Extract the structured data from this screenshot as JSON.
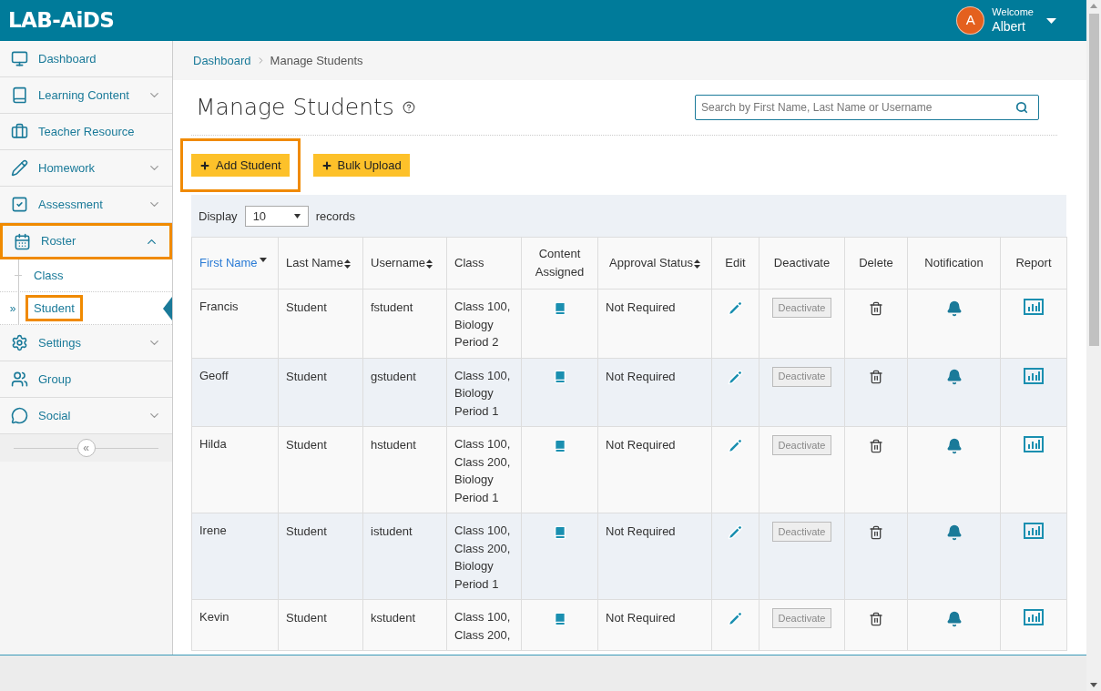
{
  "header": {
    "logo": "LAB-AiDS",
    "avatar_letter": "A",
    "welcome": "Welcome",
    "user": "Albert"
  },
  "sidebar": {
    "items": [
      {
        "label": "Dashboard",
        "has_chevron": false,
        "highlighted": false
      },
      {
        "label": "Learning Content",
        "has_chevron": true,
        "expanded": false,
        "highlighted": false
      },
      {
        "label": "Teacher Resource",
        "has_chevron": false,
        "highlighted": false
      },
      {
        "label": "Homework",
        "has_chevron": true,
        "expanded": false,
        "highlighted": false
      },
      {
        "label": "Assessment",
        "has_chevron": true,
        "expanded": false,
        "highlighted": false
      },
      {
        "label": "Roster",
        "has_chevron": true,
        "expanded": true,
        "highlighted": true,
        "children": [
          {
            "label": "Class",
            "selected": false,
            "highlighted": false
          },
          {
            "label": "Student",
            "selected": true,
            "highlighted": true,
            "marker": "»"
          }
        ]
      },
      {
        "label": "Settings",
        "has_chevron": true,
        "expanded": false,
        "highlighted": false
      },
      {
        "label": "Group",
        "has_chevron": false,
        "highlighted": false
      },
      {
        "label": "Social",
        "has_chevron": true,
        "expanded": false,
        "highlighted": false
      }
    ],
    "collapse": "«"
  },
  "breadcrumb": [
    "Dashboard",
    "Manage Students"
  ],
  "page_title": "Manage Students",
  "search": {
    "placeholder": "Search by First Name, Last Name or Username"
  },
  "buttons": [
    {
      "label": "Add Student",
      "highlighted": true
    },
    {
      "label": "Bulk Upload",
      "highlighted": false
    }
  ],
  "display": {
    "label": "Display",
    "value": "10",
    "suffix": "records"
  },
  "table": {
    "columns": [
      {
        "label": "First Name",
        "sortable": true,
        "selected": true
      },
      {
        "label": "Last Name",
        "sortable": true,
        "selected": false
      },
      {
        "label": "Username",
        "sortable": true,
        "selected": false
      },
      {
        "label": "Class",
        "sortable": false,
        "selected": false
      },
      {
        "label": "Content Assigned",
        "sortable": false,
        "selected": false
      },
      {
        "label": "Approval Status",
        "sortable": true,
        "selected": false
      },
      {
        "label": "Edit",
        "sortable": false,
        "selected": false
      },
      {
        "label": "Deactivate",
        "sortable": false,
        "selected": false
      },
      {
        "label": "Delete",
        "sortable": false,
        "selected": false
      },
      {
        "label": "Notification",
        "sortable": false,
        "selected": false
      },
      {
        "label": "Report",
        "sortable": false,
        "selected": false
      }
    ],
    "rows": [
      {
        "first": "Francis",
        "last": "Student",
        "username": "fstudent",
        "class": [
          "Class 100,",
          "Biology",
          "Period 2"
        ],
        "approval": "Not Required",
        "action": "Deactivate"
      },
      {
        "first": "Geoff",
        "last": "Student",
        "username": "gstudent",
        "class": [
          "Class 100,",
          "Biology",
          "Period 1"
        ],
        "approval": "Not Required",
        "action": "Deactivate"
      },
      {
        "first": "Hilda",
        "last": "Student",
        "username": "hstudent",
        "class": [
          "Class 100,",
          "Class 200,",
          "Biology",
          "Period 1"
        ],
        "approval": "Not Required",
        "action": "Deactivate"
      },
      {
        "first": "Irene",
        "last": "Student",
        "username": "istudent",
        "class": [
          "Class 100,",
          "Class 200,",
          "Biology",
          "Period 1"
        ],
        "approval": "Not Required",
        "action": "Deactivate"
      },
      {
        "first": "Kevin",
        "last": "Student",
        "username": "kstudent",
        "class": [
          "Class 100,",
          "Class 200,"
        ],
        "approval": "Not Required",
        "action": "Deactivate"
      }
    ]
  }
}
